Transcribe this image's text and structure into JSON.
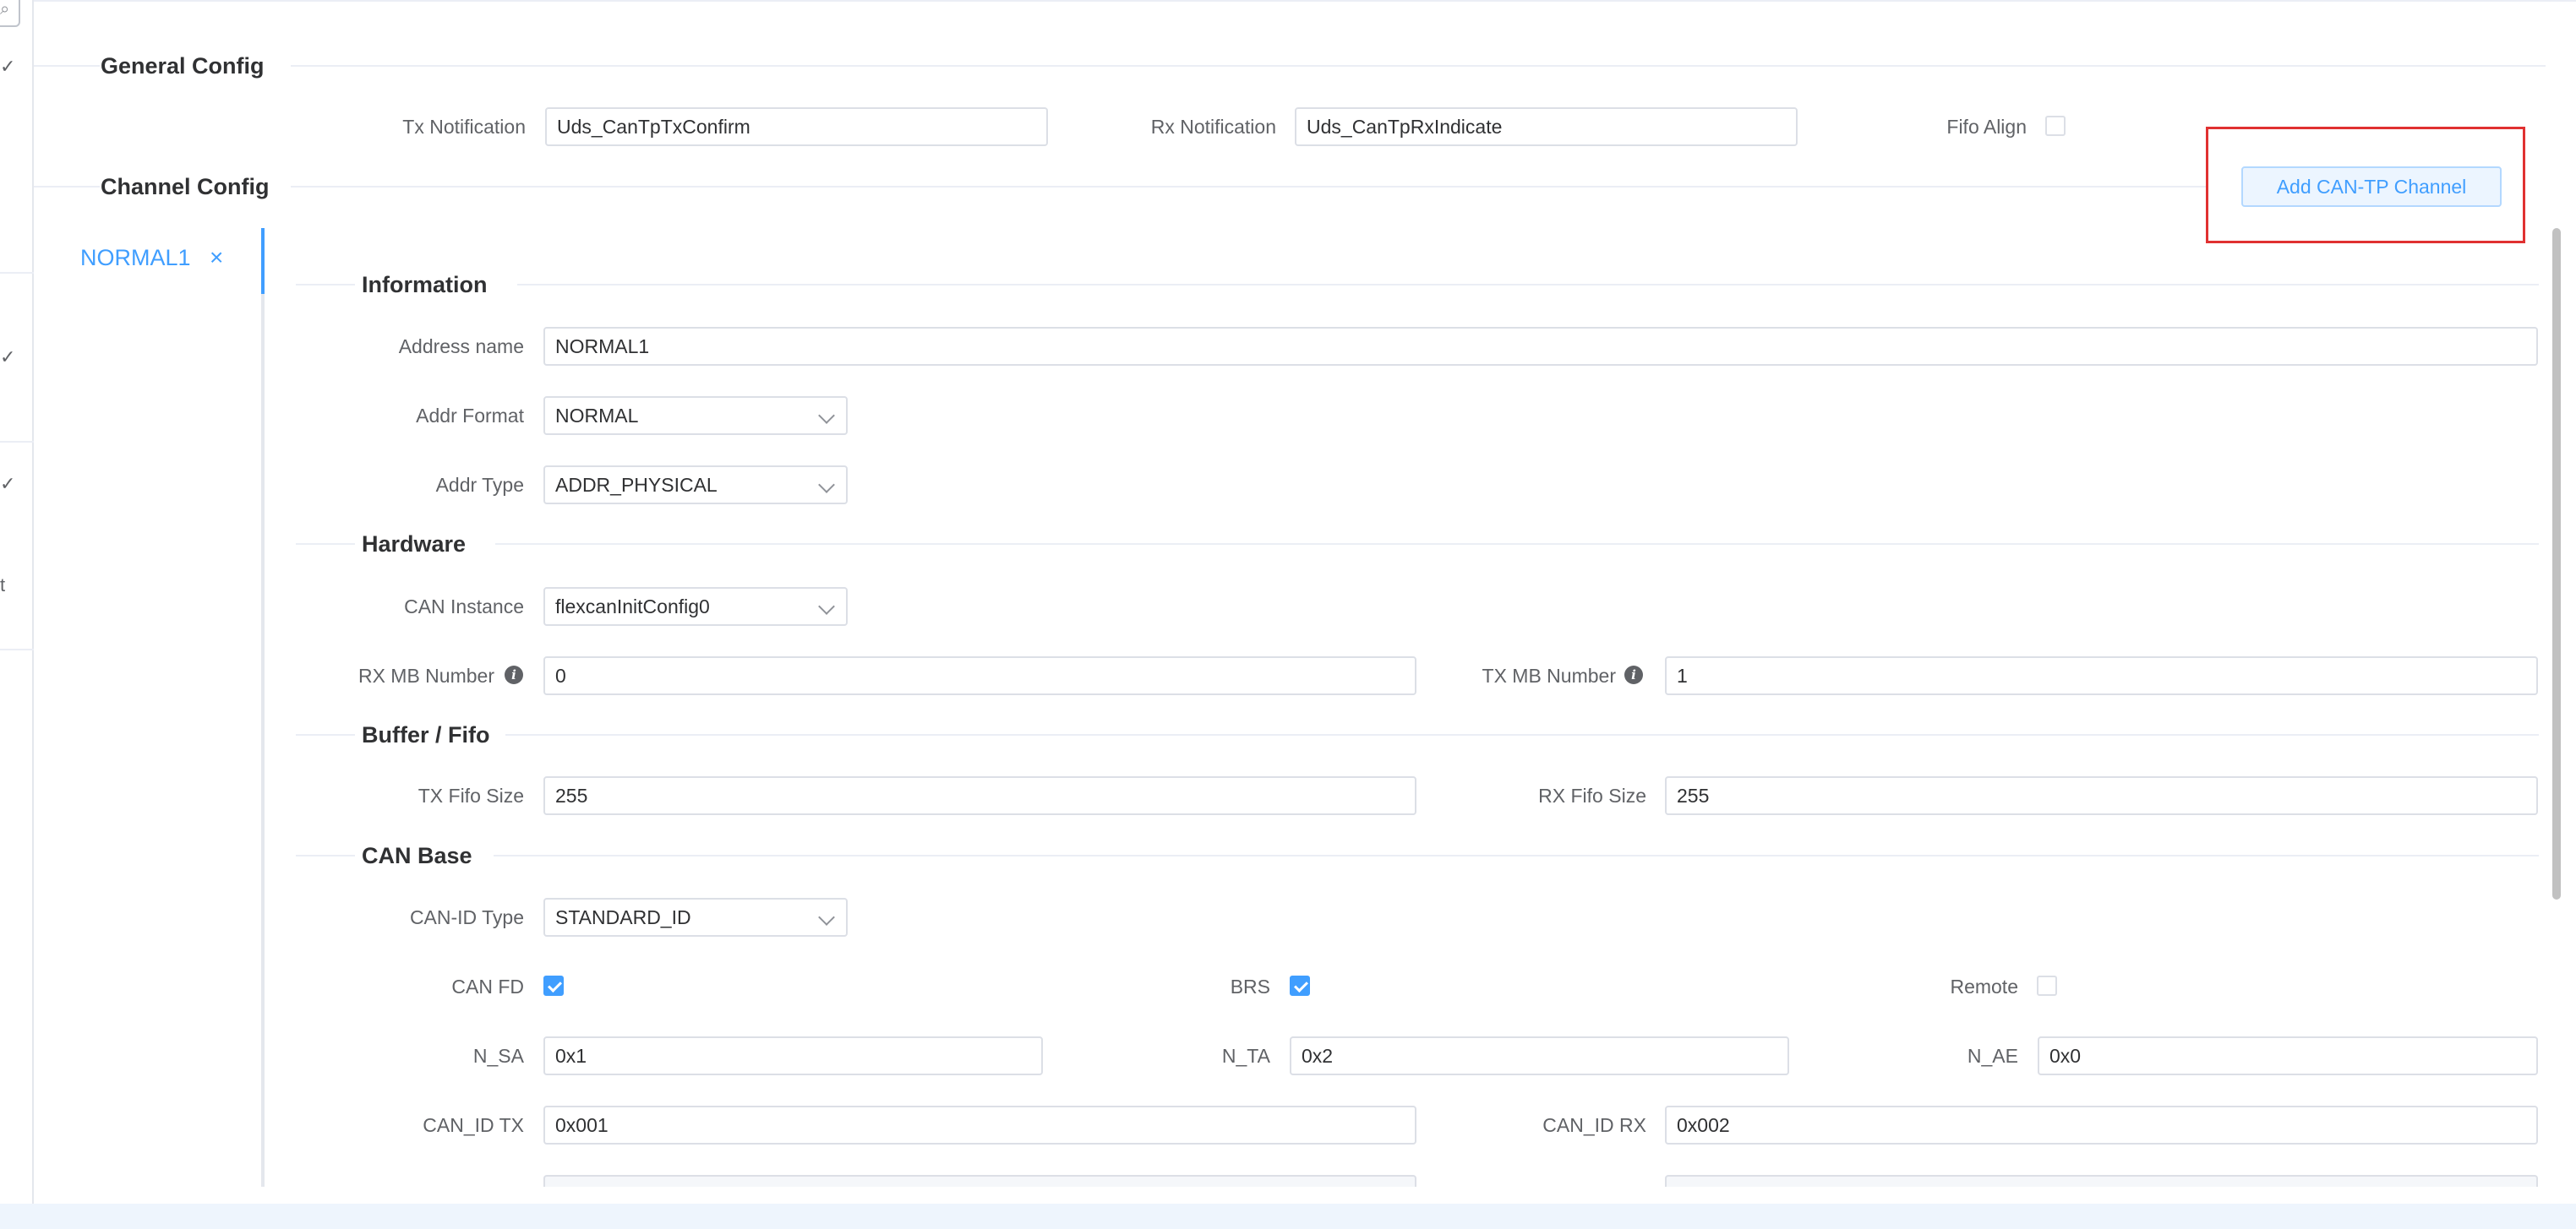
{
  "general_config": {
    "title": "General Config",
    "tx_notification_label": "Tx Notification",
    "tx_notification_value": "Uds_CanTpTxConfirm",
    "rx_notification_label": "Rx Notification",
    "rx_notification_value": "Uds_CanTpRxIndicate",
    "fifo_align_label": "Fifo Align",
    "fifo_align_checked": false
  },
  "channel_config": {
    "title": "Channel Config",
    "add_button_label": "Add CAN-TP Channel",
    "tabs": [
      {
        "label": "NORMAL1",
        "active": true,
        "close_icon": "close-icon"
      }
    ]
  },
  "information": {
    "title": "Information",
    "address_name_label": "Address name",
    "address_name_value": "NORMAL1",
    "addr_format_label": "Addr Format",
    "addr_format_value": "NORMAL",
    "addr_type_label": "Addr Type",
    "addr_type_value": "ADDR_PHYSICAL"
  },
  "hardware": {
    "title": "Hardware",
    "can_instance_label": "CAN Instance",
    "can_instance_value": "flexcanInitConfig0",
    "rx_mb_label": "RX MB Number",
    "rx_mb_value": "0",
    "tx_mb_label": "TX MB Number",
    "tx_mb_value": "1",
    "info_icon": "i"
  },
  "buffer_fifo": {
    "title": "Buffer / Fifo",
    "tx_fifo_label": "TX Fifo Size",
    "tx_fifo_value": "255",
    "rx_fifo_label": "RX Fifo Size",
    "rx_fifo_value": "255"
  },
  "can_base": {
    "title": "CAN Base",
    "can_id_type_label": "CAN-ID Type",
    "can_id_type_value": "STANDARD_ID",
    "can_fd_label": "CAN FD",
    "can_fd_checked": true,
    "brs_label": "BRS",
    "brs_checked": true,
    "remote_label": "Remote",
    "remote_checked": false,
    "n_sa_label": "N_SA",
    "n_sa_value": "0x1",
    "n_ta_label": "N_TA",
    "n_ta_value": "0x2",
    "n_ae_label": "N_AE",
    "n_ae_value": "0x0",
    "can_id_tx_label": "CAN_ID TX",
    "can_id_tx_value": "0x001",
    "can_id_rx_label": "CAN_ID RX",
    "can_id_rx_value": "0x002"
  },
  "left_strip": {
    "glyphs": [
      "✓",
      "✓",
      "✓",
      "t"
    ],
    "search_icon": "⌕"
  },
  "colors": {
    "accent": "#409eff",
    "highlight_frame": "#e03131",
    "border": "#dcdfe6"
  }
}
